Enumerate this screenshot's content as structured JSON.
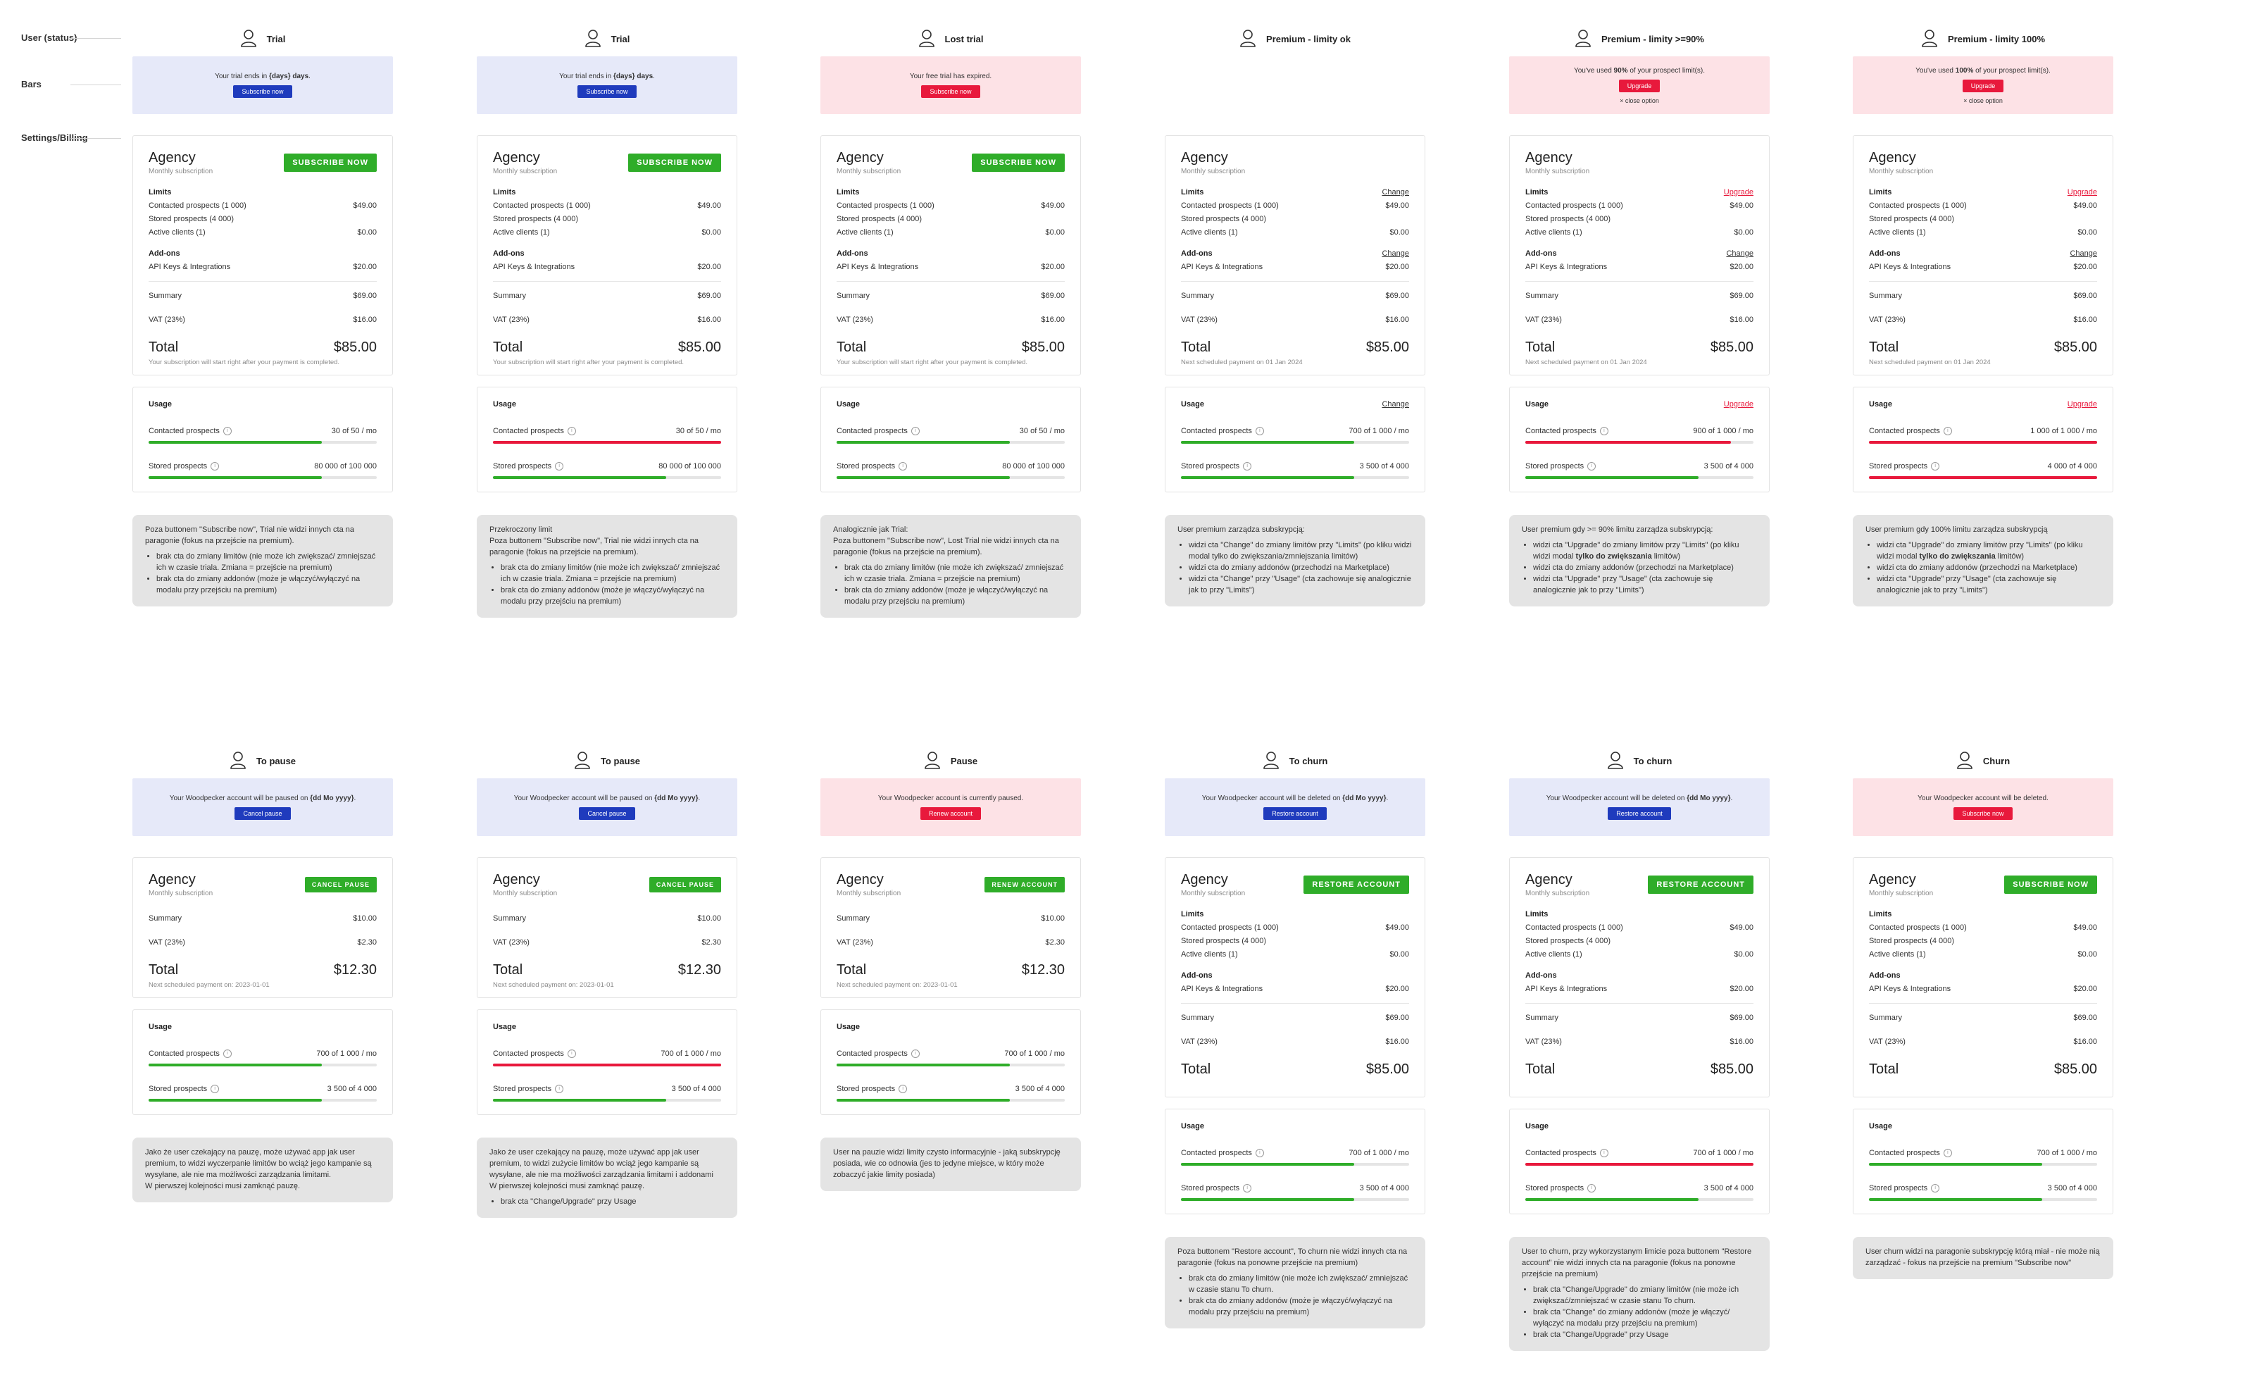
{
  "row_labels": {
    "user_status": "User (status)",
    "bars": "Bars",
    "settings_billing": "Settings/Billing"
  },
  "columns": [
    {
      "title": "Trial",
      "bar": {
        "theme": "blue",
        "html_msg": "Your trial ends in <b>{days} days</b>.",
        "button": "Subscribe now",
        "button_color": "#1f3bbd"
      },
      "card": {
        "plan": "Agency",
        "sub": "Monthly subscription",
        "action": "SUBSCRIBE NOW",
        "limits_link": "",
        "addons_link": "",
        "items": [
          [
            "Contacted prospects (1 000)",
            "$49.00"
          ],
          [
            "Stored prospects (4 000)",
            ""
          ],
          [
            "Active clients (1)",
            "$0.00"
          ]
        ],
        "addons": [
          [
            "API Keys & Integrations",
            "$20.00"
          ]
        ],
        "summary": "$69.00",
        "vat": "$16.00",
        "total": "$85.00",
        "total_note": "Your subscription will start right after your payment is completed."
      },
      "usage": {
        "link": "",
        "contacted": "30 of 50 / mo",
        "contacted_level": 0.76,
        "contacted_color": "green",
        "stored": "80 000 of 100 000",
        "stored_level": 0.76
      },
      "note": {
        "intro": "Poza buttonem \"Subscribe now\", Trial nie widzi innych cta na paragonie (fokus na przejście na premium).",
        "bullets": [
          "brak cta do zmiany limitów (nie może ich zwiększać/ zmniejszać ich w czasie triala. Zmiana = przejście na premium)",
          "brak cta do zmiany addonów (może je włączyć/wyłączyć na modalu przy przejściu na premium)"
        ]
      }
    },
    {
      "title": "Trial",
      "bar": {
        "theme": "blue",
        "html_msg": "Your trial ends in <b>{days} days</b>.",
        "button": "Subscribe now",
        "button_color": "#1f3bbd"
      },
      "card": {
        "plan": "Agency",
        "sub": "Monthly subscription",
        "action": "SUBSCRIBE NOW",
        "limits_link": "",
        "addons_link": "",
        "items": [
          [
            "Contacted prospects (1 000)",
            "$49.00"
          ],
          [
            "Stored prospects (4 000)",
            ""
          ],
          [
            "Active clients (1)",
            "$0.00"
          ]
        ],
        "addons": [
          [
            "API Keys & Integrations",
            "$20.00"
          ]
        ],
        "summary": "$69.00",
        "vat": "$16.00",
        "total": "$85.00",
        "total_note": "Your subscription will start right after your payment is completed."
      },
      "usage": {
        "link": "",
        "contacted": "30 of 50 / mo",
        "contacted_level": 1.0,
        "contacted_color": "red",
        "stored": "80 000 of 100 000",
        "stored_level": 0.76
      },
      "note": {
        "intro": "Przekroczony limit\nPoza buttonem \"Subscribe now\", Trial nie widzi innych cta na paragonie (fokus na przejście na premium).",
        "bullets": [
          "brak cta do zmiany limitów (nie może ich zwiększać/ zmniejszać ich w czasie triala. Zmiana = przejście na premium)",
          "brak cta do zmiany addonów (może je włączyć/wyłączyć na modalu przy przejściu na premium)"
        ]
      }
    },
    {
      "title": "Lost trial",
      "bar": {
        "theme": "pink",
        "html_msg": "Your free trial has expired.",
        "button": "Subscribe now",
        "button_color": "#e8193c"
      },
      "card": {
        "plan": "Agency",
        "sub": "Monthly subscription",
        "action": "SUBSCRIBE NOW",
        "limits_link": "",
        "addons_link": "",
        "items": [
          [
            "Contacted prospects (1 000)",
            "$49.00"
          ],
          [
            "Stored prospects (4 000)",
            ""
          ],
          [
            "Active clients (1)",
            "$0.00"
          ]
        ],
        "addons": [
          [
            "API Keys & Integrations",
            "$20.00"
          ]
        ],
        "summary": "$69.00",
        "vat": "$16.00",
        "total": "$85.00",
        "total_note": "Your subscription will start right after your payment is completed."
      },
      "usage": {
        "link": "",
        "contacted": "30 of 50 / mo",
        "contacted_level": 0.76,
        "contacted_color": "green",
        "stored": "80 000 of 100 000",
        "stored_level": 0.76
      },
      "note": {
        "intro": "Analogicznie jak Trial:\nPoza buttonem \"Subscribe now\", Lost Trial nie widzi innych cta na paragonie (fokus na przejście na premium).",
        "bullets": [
          "brak cta do zmiany limitów (nie może ich zwiększać/ zmniejszać ich w czasie triala. Zmiana = przejście na premium)",
          "brak cta do zmiany addonów (może je włączyć/wyłączyć na modalu przy przejściu na premium)"
        ]
      }
    },
    {
      "title": "Premium - limity ok",
      "bar": null,
      "card": {
        "plan": "Agency",
        "sub": "Monthly subscription",
        "action": "",
        "limits_link": "Change",
        "addons_link": "Change",
        "items": [
          [
            "Contacted prospects (1 000)",
            "$49.00"
          ],
          [
            "Stored prospects (4 000)",
            ""
          ],
          [
            "Active clients (1)",
            "$0.00"
          ]
        ],
        "addons": [
          [
            "API Keys & Integrations",
            "$20.00"
          ]
        ],
        "summary": "$69.00",
        "vat": "$16.00",
        "total": "$85.00",
        "total_note": "Next scheduled payment on 01 Jan 2024"
      },
      "usage": {
        "link": "Change",
        "contacted": "700 of 1 000 / mo",
        "contacted_level": 0.76,
        "contacted_color": "green",
        "stored": "3 500 of 4 000",
        "stored_level": 0.76
      },
      "note": {
        "intro": "User premium zarządza subskrypcją:",
        "bullets": [
          "widzi cta \"Change\" do zmiany limitów przy \"Limits\" (po kliku widzi modal tylko do zwiększania/zmniejszania limitów)",
          "widzi cta do zmiany addonów (przechodzi na Marketplace)",
          "widzi cta \"Change\" przy \"Usage\" (cta zachowuje się analogicznie jak to przy \"Limits\")"
        ]
      }
    },
    {
      "title": "Premium - limity >=90%",
      "bar": {
        "theme": "pink",
        "html_msg": "You've used <b>90%</b> of your prospect limit(s).",
        "button": "Upgrade",
        "button_color": "#e8193c",
        "close": "close option"
      },
      "card": {
        "plan": "Agency",
        "sub": "Monthly subscription",
        "action": "",
        "limits_link": "Upgrade",
        "addons_link": "Change",
        "items": [
          [
            "Contacted prospects (1 000)",
            "$49.00"
          ],
          [
            "Stored prospects (4 000)",
            ""
          ],
          [
            "Active clients (1)",
            "$0.00"
          ]
        ],
        "addons": [
          [
            "API Keys & Integrations",
            "$20.00"
          ]
        ],
        "summary": "$69.00",
        "vat": "$16.00",
        "total": "$85.00",
        "total_note": "Next scheduled payment on 01 Jan 2024"
      },
      "usage": {
        "link": "Upgrade",
        "contacted": "900 of 1 000 / mo",
        "contacted_level": 0.9,
        "contacted_color": "red",
        "stored": "3 500 of 4 000",
        "stored_level": 0.76
      },
      "note": {
        "intro": "User premium gdy >= 90% limitu zarządza subskrypcją:",
        "bullets": [
          "widzi cta \"Upgrade\" do zmiany limitów przy \"Limits\" (po kliku widzi modal <b>tylko do zwiększania</b> limitów)",
          "widzi cta do zmiany addonów (przechodzi na Marketplace)",
          "widzi cta \"Upgrade\" przy \"Usage\" (cta zachowuje się analogicznie jak to przy \"Limits\")"
        ]
      }
    },
    {
      "title": "Premium - limity 100%",
      "bar": {
        "theme": "pink",
        "html_msg": "You've used <b>100%</b> of your prospect limit(s).",
        "button": "Upgrade",
        "button_color": "#e8193c",
        "close": "close option"
      },
      "card": {
        "plan": "Agency",
        "sub": "Monthly subscription",
        "action": "",
        "limits_link": "Upgrade",
        "addons_link": "Change",
        "items": [
          [
            "Contacted prospects (1 000)",
            "$49.00"
          ],
          [
            "Stored prospects (4 000)",
            ""
          ],
          [
            "Active clients (1)",
            "$0.00"
          ]
        ],
        "addons": [
          [
            "API Keys & Integrations",
            "$20.00"
          ]
        ],
        "summary": "$69.00",
        "vat": "$16.00",
        "total": "$85.00",
        "total_note": "Next scheduled payment on 01 Jan 2024"
      },
      "usage": {
        "link": "Upgrade",
        "contacted": "1 000 of 1 000 / mo",
        "contacted_level": 1.0,
        "contacted_color": "red",
        "stored": "4 000 of 4 000",
        "stored_level": 1.0,
        "stored_color": "red"
      },
      "note": {
        "intro": "User premium gdy 100% limitu zarządza subskrypcją",
        "bullets": [
          "widzi cta \"Upgrade\" do zmiany limitów przy \"Limits\" (po kliku widzi modal <b>tylko do zwiększania</b> limitów)",
          "widzi cta do zmiany addonów (przechodzi na Marketplace)",
          "widzi cta \"Upgrade\" przy \"Usage\" (cta zachowuje się analogicznie jak to przy \"Limits\")"
        ]
      }
    },
    {
      "title": "To pause",
      "bar": {
        "theme": "blue",
        "html_msg": "Your Woodpecker account will be paused on <b>{dd Mo yyyy}</b>.",
        "button": "Cancel pause",
        "button_color": "#1f3bbd"
      },
      "card": {
        "plan": "Agency",
        "sub": "Monthly subscription",
        "action": "CANCEL PAUSE",
        "small": true,
        "items": [],
        "addons": [],
        "summary": "$10.00",
        "vat": "$2.30",
        "total": "$12.30",
        "total_note": "Next scheduled payment on: 2023-01-01"
      },
      "usage": {
        "link": "",
        "contacted": "700 of 1 000 / mo",
        "contacted_level": 0.76,
        "contacted_color": "green",
        "stored": "3 500 of 4 000",
        "stored_level": 0.76
      },
      "note": {
        "intro": "Jako że user czekający na pauzę, może używać app jak user premium, to widzi wyczerpanie limitów bo wciąż jego kampanie są wysyłane, ale nie ma możliwości zarządzania limitami.\nW pierwszej kolejności musi zamknąć pauzę.",
        "bullets": []
      }
    },
    {
      "title": "To pause",
      "bar": {
        "theme": "blue",
        "html_msg": "Your Woodpecker account will be paused on <b>{dd Mo yyyy}</b>.",
        "button": "Cancel pause",
        "button_color": "#1f3bbd"
      },
      "card": {
        "plan": "Agency",
        "sub": "Monthly subscription",
        "action": "CANCEL PAUSE",
        "small": true,
        "items": [],
        "addons": [],
        "summary": "$10.00",
        "vat": "$2.30",
        "total": "$12.30",
        "total_note": "Next scheduled payment on: 2023-01-01"
      },
      "usage": {
        "link": "",
        "contacted": "700 of 1 000 / mo",
        "contacted_level": 1.0,
        "contacted_color": "red",
        "stored": "3 500 of 4 000",
        "stored_level": 0.76
      },
      "note": {
        "intro": "Jako że user czekający na pauzę, może używać app jak user premium, to widzi zużycie limitów bo wciąż jego kampanie są wysyłane, ale nie ma możliwości zarządzania limitami i addonami\nW pierwszej kolejności musi zamknąć pauzę.",
        "bullets": [
          "brak cta \"Change/Upgrade\" przy Usage"
        ]
      }
    },
    {
      "title": "Pause",
      "bar": {
        "theme": "pink",
        "html_msg": "Your Woodpecker account is currently paused.",
        "button": "Renew account",
        "button_color": "#e8193c"
      },
      "card": {
        "plan": "Agency",
        "sub": "Monthly subscription",
        "action": "RENEW ACCOUNT",
        "small": true,
        "items": [],
        "addons": [],
        "summary": "$10.00",
        "vat": "$2.30",
        "total": "$12.30",
        "total_note": "Next scheduled payment on: 2023-01-01"
      },
      "usage": {
        "link": "",
        "contacted": "700 of 1 000 / mo",
        "contacted_level": 0.76,
        "contacted_color": "green",
        "stored": "3 500 of 4 000",
        "stored_level": 0.76
      },
      "note": {
        "intro": "User na pauzie widzi limity czysto informacyjnie - jaką subskrypcję posiada, wie co odnowia (jes to jedyne miejsce, w który może zobaczyć jakie limity posiada)",
        "bullets": []
      }
    },
    {
      "title": "To churn",
      "bar": {
        "theme": "blue",
        "html_msg": "Your Woodpecker account will be deleted on <b>{dd Mo yyyy}</b>.",
        "button": "Restore account",
        "button_color": "#1f3bbd"
      },
      "card": {
        "plan": "Agency",
        "sub": "Monthly subscription",
        "action": "RESTORE ACCOUNT",
        "limits_link": "",
        "addons_link": "",
        "items": [
          [
            "Contacted prospects (1 000)",
            "$49.00"
          ],
          [
            "Stored prospects (4 000)",
            ""
          ],
          [
            "Active clients (1)",
            "$0.00"
          ]
        ],
        "addons": [
          [
            "API Keys & Integrations",
            "$20.00"
          ]
        ],
        "summary": "$69.00",
        "vat": "$16.00",
        "total": "$85.00",
        "total_note": ""
      },
      "usage": {
        "link": "",
        "contacted": "700 of 1 000 / mo",
        "contacted_level": 0.76,
        "contacted_color": "green",
        "stored": "3 500 of 4 000",
        "stored_level": 0.76
      },
      "note": {
        "intro": "Poza buttonem \"Restore account\", To churn nie widzi innych cta na paragonie (fokus na ponowne przejście na premium)",
        "bullets": [
          "brak cta do zmiany limitów (nie może ich zwiększać/ zmniejszać w czasie stanu To churn.",
          "brak cta do zmiany addonów (może je włączyć/wyłączyć na modalu przy przejściu na premium)"
        ]
      }
    },
    {
      "title": "To churn",
      "bar": {
        "theme": "blue",
        "html_msg": "Your Woodpecker account will be deleted on <b>{dd Mo yyyy}</b>.",
        "button": "Restore account",
        "button_color": "#1f3bbd"
      },
      "card": {
        "plan": "Agency",
        "sub": "Monthly subscription",
        "action": "RESTORE ACCOUNT",
        "limits_link": "",
        "addons_link": "",
        "items": [
          [
            "Contacted prospects (1 000)",
            "$49.00"
          ],
          [
            "Stored prospects (4 000)",
            ""
          ],
          [
            "Active clients (1)",
            "$0.00"
          ]
        ],
        "addons": [
          [
            "API Keys & Integrations",
            "$20.00"
          ]
        ],
        "summary": "$69.00",
        "vat": "$16.00",
        "total": "$85.00",
        "total_note": ""
      },
      "usage": {
        "link": "",
        "contacted": "700 of 1 000 / mo",
        "contacted_level": 1.0,
        "contacted_color": "red",
        "stored": "3 500 of 4 000",
        "stored_level": 0.76
      },
      "note": {
        "intro": "User to churn, przy wykorzystanym limicie poza buttonem \"Restore account\" nie widzi innych cta na paragonie (fokus na ponowne przejście na premium)",
        "bullets": [
          "brak cta \"Change/Upgrade\" do zmiany limitów (nie może ich zwiększać/zmniejszać w czasie stanu To churn.",
          "brak cta \"Change\" do zmiany addonów (może je włączyć/ wyłączyć na modalu przy przejściu na premium)",
          "brak cta \"Change/Upgrade\" przy Usage"
        ]
      }
    },
    {
      "title": "Churn",
      "bar": {
        "theme": "pink",
        "html_msg": "Your Woodpecker account will be deleted.",
        "button": "Subscribe now",
        "button_color": "#e8193c"
      },
      "card": {
        "plan": "Agency",
        "sub": "Monthly subscription",
        "action": "SUBSCRIBE NOW",
        "limits_link": "",
        "addons_link": "",
        "items": [
          [
            "Contacted prospects (1 000)",
            "$49.00"
          ],
          [
            "Stored prospects (4 000)",
            ""
          ],
          [
            "Active clients (1)",
            "$0.00"
          ]
        ],
        "addons": [
          [
            "API Keys & Integrations",
            "$20.00"
          ]
        ],
        "summary": "$69.00",
        "vat": "$16.00",
        "total": "$85.00",
        "total_note": ""
      },
      "usage": {
        "link": "",
        "contacted": "700 of 1 000 / mo",
        "contacted_level": 0.76,
        "contacted_color": "green",
        "stored": "3 500 of 4 000",
        "stored_level": 0.76
      },
      "note": {
        "intro": "User churn widzi na paragonie subskrypcję którą miał - nie może nią zarządzać - fokus na przejście na premium \"Subscribe now\"",
        "bullets": []
      }
    }
  ],
  "labels": {
    "limits": "Limits",
    "addons": "Add-ons",
    "summary": "Summary",
    "vat": "VAT (23%)",
    "total": "Total",
    "usage": "Usage",
    "contacted": "Contacted prospects",
    "stored": "Stored prospects",
    "info_icon": "i"
  },
  "colors": {
    "accent_green": "#2fad29",
    "accent_red": "#e8193c",
    "accent_blue": "#1f3bbd",
    "bar_blue": "#e6e9f9",
    "bar_pink": "#fde2e6"
  }
}
